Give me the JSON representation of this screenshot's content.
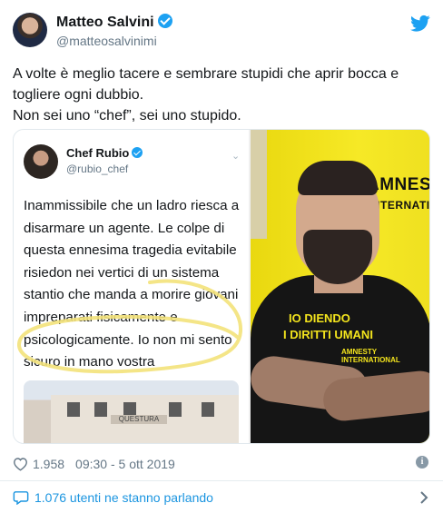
{
  "author": {
    "name": "Matteo Salvini",
    "handle": "@matteosalvinimi"
  },
  "tweet_text": [
    "A volte è meglio tacere e sembrare stupidi che aprir bocca e",
    "togliere ogni dubbio.",
    "Non sei uno “chef”, sei uno stupido."
  ],
  "quoted_screenshot": {
    "name": "Chef Rubio",
    "handle": "@rubio_chef",
    "text_lines": [
      "Inammissibile che un ladro riesca a",
      "disarmare un agente. Le colpe di",
      "questa ennesima tragedia evitabile",
      "risiedon nei vertici di un sistema",
      "stantio che manda a morire giovani",
      "impreparati fisicamente e",
      "psicologicamente. Io non mi sento",
      "sicuro in mano vostra"
    ],
    "building_sign": "QUESTURA",
    "highlight_color": "#f3e27a"
  },
  "photo": {
    "wall_sign_line1": "AMNEST",
    "wall_sign_line2": "INTERNATION",
    "shirt_line1": "IO DIENDO",
    "shirt_line2": "I DIRITTI UMANI",
    "shirt_logo": "AMNESTY INTERNATIONAL"
  },
  "meta": {
    "likes": "1.958",
    "timestamp": "09:30 - 5 ott 2019"
  },
  "conversation": {
    "label": "1.076 utenti ne stanno parlando"
  },
  "icons": {
    "brand": "twitter-bird-icon",
    "verified": "verified-badge-icon",
    "like": "heart-icon",
    "info": "info-icon",
    "reply": "speech-bubble-icon",
    "more": "chevron-right-icon"
  },
  "colors": {
    "link_blue": "#1b95e0",
    "verified_blue": "#1da1f2",
    "muted_text": "#657786",
    "amnesty_yellow": "#f2e419"
  }
}
